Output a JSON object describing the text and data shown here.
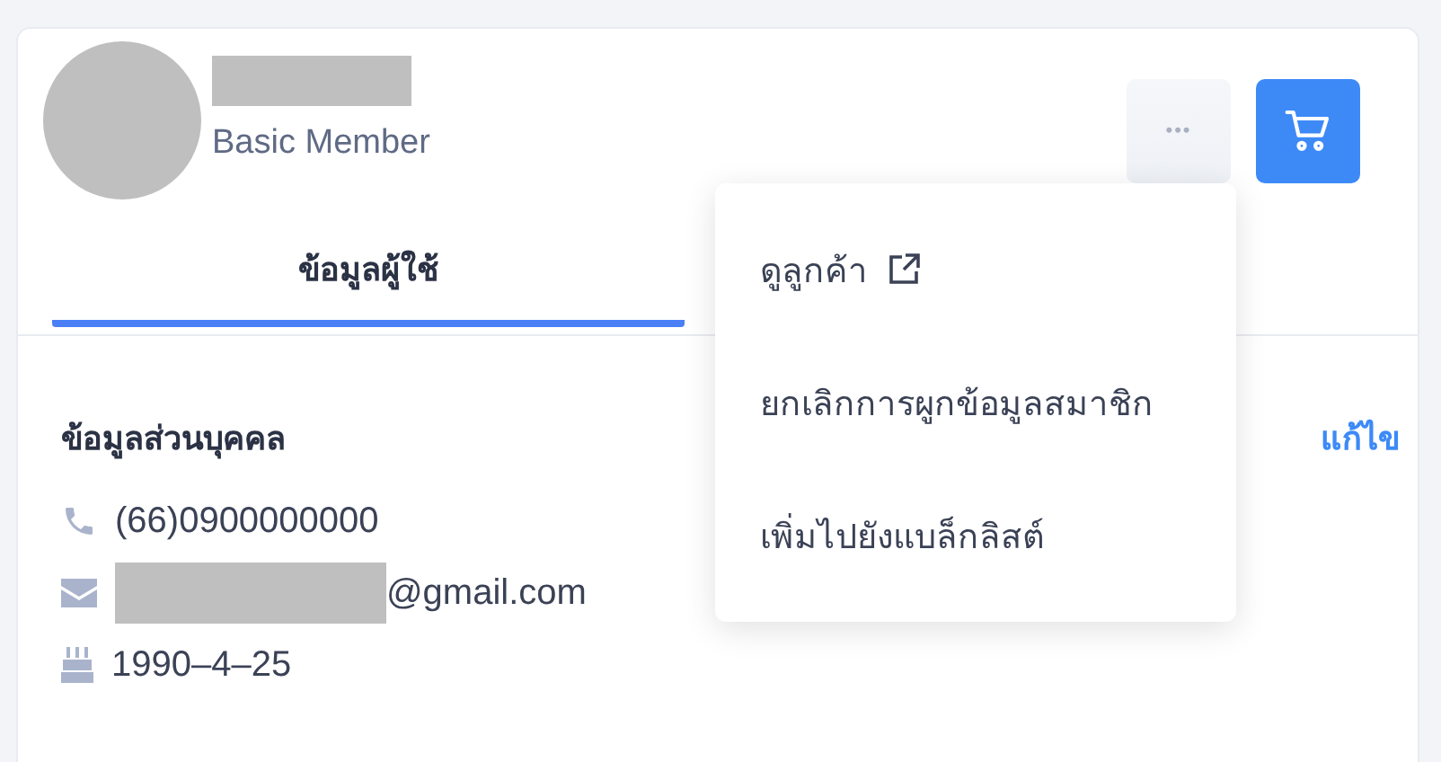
{
  "profile": {
    "member_level": "Basic Member",
    "name_hidden": true
  },
  "header_buttons": [
    {
      "kind": "more",
      "label": "•••"
    },
    {
      "kind": "cart"
    }
  ],
  "tabs": [
    {
      "label": "ข้อมูลผู้ใช้",
      "selected": true
    }
  ],
  "section": {
    "title": "ข้อมูลส่วนบุคคล",
    "edit_link": "แก้ไข"
  },
  "details": [
    {
      "kind": "phone",
      "value": "(66)0900000000",
      "hidden_prefix": false
    },
    {
      "kind": "email",
      "value": "@gmail.com",
      "hidden_prefix": true
    },
    {
      "kind": "birthday",
      "value": "1990–4–25",
      "hidden_prefix": false
    }
  ],
  "menu": {
    "open": true,
    "items": [
      {
        "label": "ดูลูกค้า",
        "external": true
      },
      {
        "label": "ยกเลิกการผูกข้อมูลสมาชิก",
        "external": false
      },
      {
        "label": "เพิ่มไปยังแบล็กลิสต์",
        "external": false
      }
    ]
  }
}
